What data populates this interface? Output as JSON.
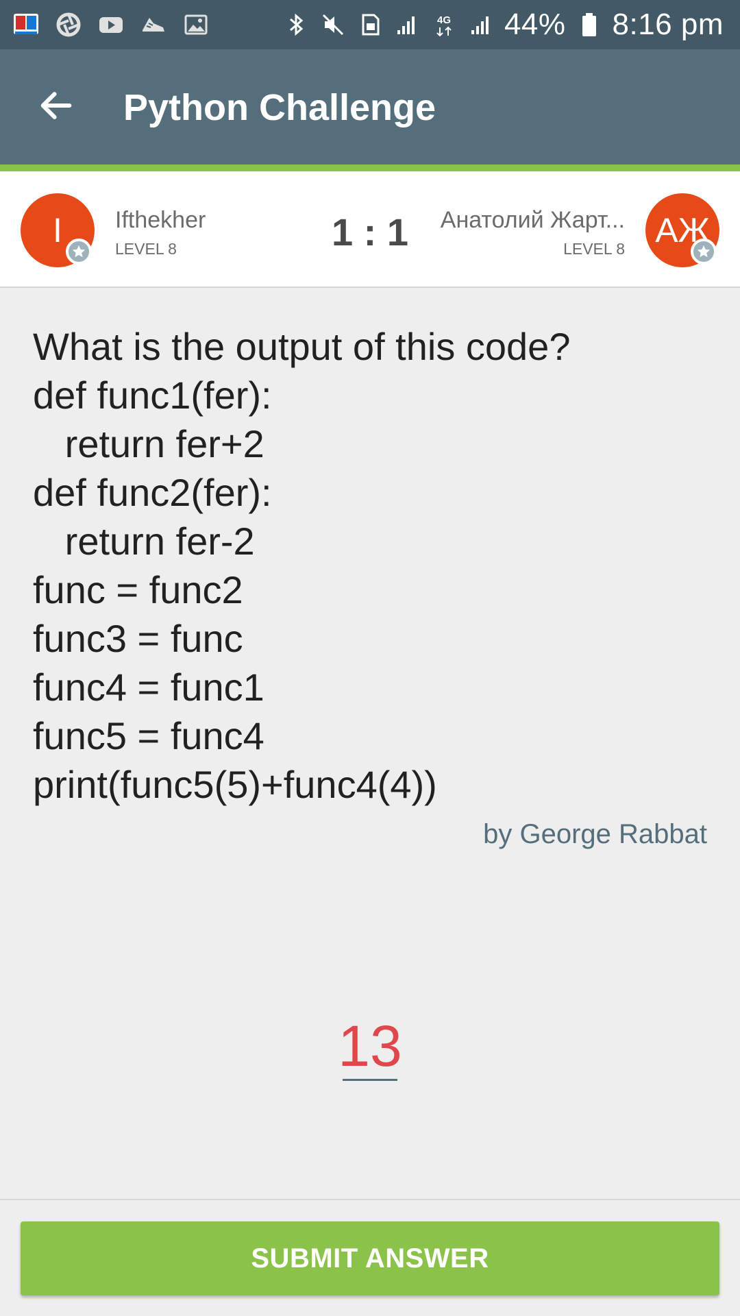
{
  "status_bar": {
    "battery": "44%",
    "time": "8:16 pm",
    "network_label": "4G",
    "left_icons": [
      "bangla-dictionary-app-icon",
      "aperture-app-icon",
      "youtube-icon",
      "shoe-app-icon",
      "gallery-icon"
    ],
    "right_icons": [
      "bluetooth-icon",
      "mute-icon",
      "sim-icon",
      "signal-icon",
      "signal-icon",
      "battery-icon"
    ]
  },
  "app_bar": {
    "title": "Python Challenge"
  },
  "players": {
    "left": {
      "initial": "I",
      "name": "Ifthekher",
      "level": "LEVEL 8"
    },
    "right": {
      "initial": "АЖ",
      "name": "Анатолий Жарт...",
      "level": "LEVEL 8"
    },
    "score": "1 : 1"
  },
  "question": {
    "lines": [
      "What is the output of this code?",
      "def func1(fer):",
      "   return fer+2",
      "def func2(fer):",
      "   return fer-2",
      "func = func2",
      "func3 = func",
      "func4 = func1",
      "func5 = func4",
      "print(func5(5)+func4(4))"
    ],
    "author": "by George Rabbat"
  },
  "answer": {
    "value": "13"
  },
  "submit": {
    "label": "SUBMIT ANSWER"
  },
  "colors": {
    "status_bar": "#435a66",
    "app_bar": "#546f7b",
    "accent_green": "#8bc34a",
    "avatar": "#e64a19",
    "answer_red": "#e0474c"
  }
}
